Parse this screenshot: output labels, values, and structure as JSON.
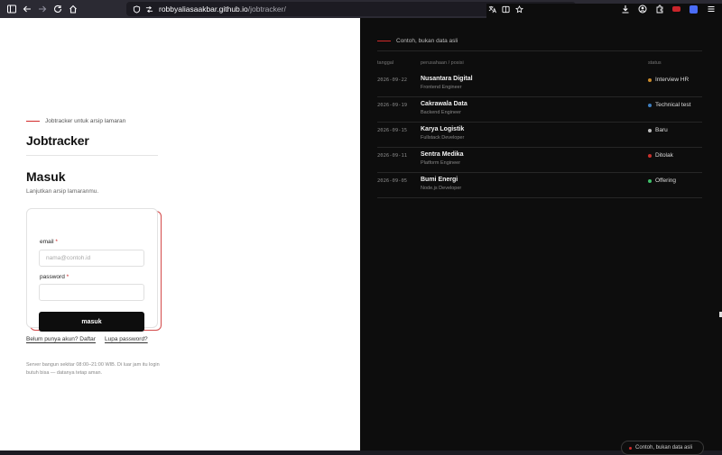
{
  "browser": {
    "url_host": "robbyaliasaakbar.github.io",
    "url_path": "/jobtracker/"
  },
  "login": {
    "eyebrow": "Jobtracker untuk arsip lamaran",
    "brand": "Jobtracker",
    "heading": "Masuk",
    "subheading": "Lanjutkan arsip lamaranmu.",
    "email_label": "email",
    "email_placeholder": "nama@contoh.id",
    "email_value": "",
    "password_label": "password",
    "password_value": "",
    "required_mark": "*",
    "submit_label": "masuk",
    "register_link": "Belum punya akun? Daftar",
    "forgot_link": "Lupa password?",
    "server_note": "Server bangun sekitar 08:00–21:00 WIB. Di luar jam itu login butuh bisa — datanya tetap aman."
  },
  "preview": {
    "eyebrow": "Contoh, bukan data asli",
    "columns": {
      "date": "tanggal",
      "company": "perusahaan / posisi",
      "status": "status"
    },
    "rows": [
      {
        "date": "2026-09-22",
        "company": "Nusantara Digital",
        "position": "Frontend Engineer",
        "status": "Interview HR",
        "status_color": "#c98a2b"
      },
      {
        "date": "2026-09-19",
        "company": "Cakrawala Data",
        "position": "Backend Engineer",
        "status": "Technical test",
        "status_color": "#3f7fbf"
      },
      {
        "date": "2026-09-15",
        "company": "Karya Logistik",
        "position": "Fullstack Developer",
        "status": "Baru",
        "status_color": "#bdbdbd"
      },
      {
        "date": "2026-09-11",
        "company": "Sentra Medika",
        "position": "Platform Engineer",
        "status": "Ditolak",
        "status_color": "#c9302c"
      },
      {
        "date": "2026-09-05",
        "company": "Bumi Energi",
        "position": "Node.js Developer",
        "status": "Offering",
        "status_color": "#3fbf6a"
      }
    ],
    "badge": "Contoh, bukan data asli"
  },
  "colors": {
    "accent_red": "#d22a2a",
    "dark_bg": "#0d0d0d",
    "light_bg": "#ffffff"
  }
}
